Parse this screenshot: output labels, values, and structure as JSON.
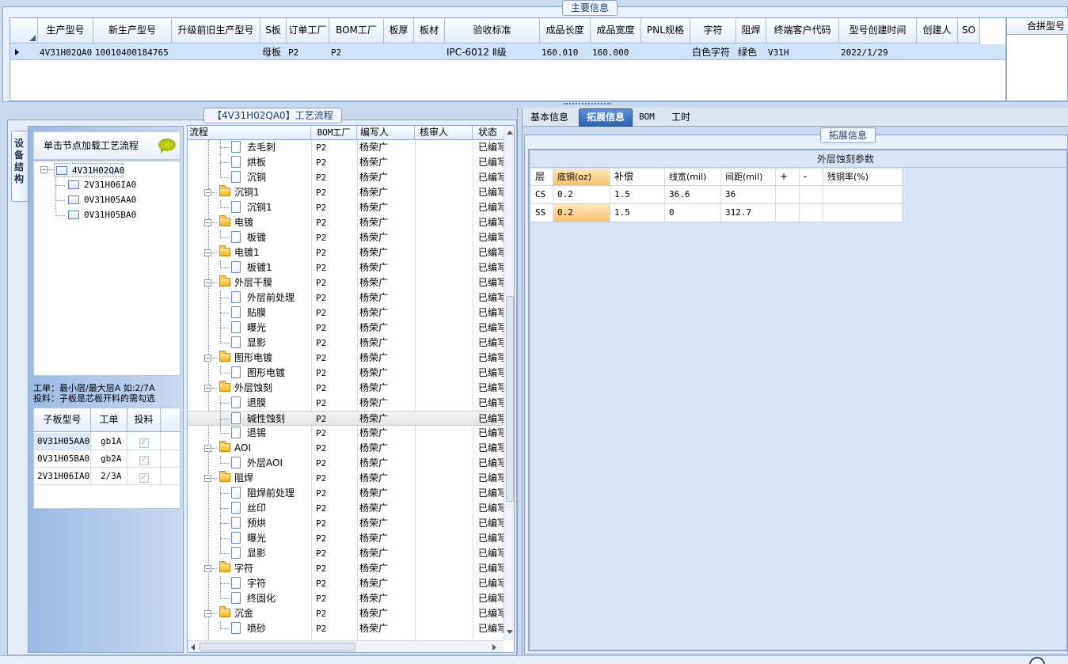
{
  "main_info": {
    "title": "主要信息",
    "merge_header": "合拼型号",
    "columns": [
      {
        "label": "生产型号",
        "w": 70
      },
      {
        "label": "新生产型号",
        "w": 99
      },
      {
        "label": "升级前旧生产型号",
        "w": 112
      },
      {
        "label": "S板",
        "w": 33
      },
      {
        "label": "订单工厂",
        "w": 54
      },
      {
        "label": "BOM工厂",
        "w": 69
      },
      {
        "label": "板厚",
        "w": 38
      },
      {
        "label": "板材",
        "w": 39
      },
      {
        "label": "验收标准",
        "w": 120
      },
      {
        "label": "成品长度",
        "w": 64
      },
      {
        "label": "成品宽度",
        "w": 64
      },
      {
        "label": "PNL规格",
        "w": 62
      },
      {
        "label": "字符",
        "w": 58
      },
      {
        "label": "阻焊",
        "w": 38
      },
      {
        "label": "终端客户代码",
        "w": 92
      },
      {
        "label": "型号创建时间",
        "w": 98
      },
      {
        "label": "创建人",
        "w": 52
      },
      {
        "label": "SO",
        "w": 28
      }
    ],
    "row": [
      "4V31H02QA0",
      "10010400184765",
      "",
      "母板",
      "P2",
      "P2",
      "",
      "",
      "IPC-6012 Ⅱ级",
      "160.010",
      "160.000",
      "",
      "白色字符",
      "绿色",
      "V31H",
      "2022/1/29",
      "",
      ""
    ]
  },
  "process": {
    "title": "【4V31H02QA0】工艺流程",
    "side_tab": "设备结构",
    "hint": "单击节点加载工艺流程",
    "note1": "工单：最小层/最大层A 如:2/7A",
    "note2": "投料：子板是芯板开料的需勾选",
    "headers": [
      "流程",
      "BOM工厂",
      "编写人",
      "核审人",
      "状态"
    ],
    "structure": [
      {
        "label": "4V31H02QA0",
        "level": 0
      },
      {
        "label": "2V31H06IA0",
        "level": 1
      },
      {
        "label": "0V31H05AA0",
        "level": 1
      },
      {
        "label": "0V31H05BA0",
        "level": 1
      }
    ],
    "rows": [
      {
        "name": "去毛刺",
        "type": "leaf",
        "factory": "P2",
        "author": "杨荣广",
        "reviewer": "",
        "status": "已编写"
      },
      {
        "name": "烘板",
        "type": "leaf",
        "factory": "P2",
        "author": "杨荣广",
        "reviewer": "",
        "status": "已编写"
      },
      {
        "name": "沉铜",
        "type": "leaf",
        "factory": "P2",
        "author": "杨荣广",
        "reviewer": "",
        "status": "已编写"
      },
      {
        "name": "沉铜1",
        "type": "folder",
        "factory": "P2",
        "author": "杨荣广",
        "reviewer": "",
        "status": "已编写"
      },
      {
        "name": "沉铜1",
        "type": "leaf",
        "factory": "P2",
        "author": "杨荣广",
        "reviewer": "",
        "status": "已编写"
      },
      {
        "name": "电镀",
        "type": "folder",
        "factory": "P2",
        "author": "杨荣广",
        "reviewer": "",
        "status": "已编写"
      },
      {
        "name": "板镀",
        "type": "leaf",
        "factory": "P2",
        "author": "杨荣广",
        "reviewer": "",
        "status": "已编写"
      },
      {
        "name": "电镀1",
        "type": "folder",
        "factory": "P2",
        "author": "杨荣广",
        "reviewer": "",
        "status": "已编写"
      },
      {
        "name": "板镀1",
        "type": "leaf",
        "factory": "P2",
        "author": "杨荣广",
        "reviewer": "",
        "status": "已编写"
      },
      {
        "name": "外层干膜",
        "type": "folder",
        "factory": "P2",
        "author": "杨荣广",
        "reviewer": "",
        "status": "已编写"
      },
      {
        "name": "外层前处理",
        "type": "leaf",
        "factory": "P2",
        "author": "杨荣广",
        "reviewer": "",
        "status": "已编写"
      },
      {
        "name": "贴膜",
        "type": "leaf",
        "factory": "P2",
        "author": "杨荣广",
        "reviewer": "",
        "status": "已编写"
      },
      {
        "name": "曝光",
        "type": "leaf",
        "factory": "P2",
        "author": "杨荣广",
        "reviewer": "",
        "status": "已编写"
      },
      {
        "name": "显影",
        "type": "leaf",
        "factory": "P2",
        "author": "杨荣广",
        "reviewer": "",
        "status": "已编写"
      },
      {
        "name": "图形电镀",
        "type": "folder",
        "factory": "P2",
        "author": "杨荣广",
        "reviewer": "",
        "status": "已编写"
      },
      {
        "name": "图形电镀",
        "type": "leaf",
        "factory": "P2",
        "author": "杨荣广",
        "reviewer": "",
        "status": "已编写"
      },
      {
        "name": "外层蚀刻",
        "type": "folder",
        "factory": "P2",
        "author": "杨荣广",
        "reviewer": "",
        "status": "已编写"
      },
      {
        "name": "退膜",
        "type": "leaf",
        "factory": "P2",
        "author": "杨荣广",
        "reviewer": "",
        "status": "已编写"
      },
      {
        "name": "碱性蚀刻",
        "type": "leaf",
        "factory": "P2",
        "author": "杨荣广",
        "reviewer": "",
        "status": "已编写",
        "selected": true
      },
      {
        "name": "退锡",
        "type": "leaf",
        "factory": "P2",
        "author": "杨荣广",
        "reviewer": "",
        "status": "已编写"
      },
      {
        "name": "AOI",
        "type": "folder",
        "factory": "P2",
        "author": "杨荣广",
        "reviewer": "",
        "status": "已编写"
      },
      {
        "name": "外层AOI",
        "type": "leaf",
        "factory": "P2",
        "author": "杨荣广",
        "reviewer": "",
        "status": "已编写"
      },
      {
        "name": "阻焊",
        "type": "folder",
        "factory": "P2",
        "author": "杨荣广",
        "reviewer": "",
        "status": "已编写"
      },
      {
        "name": "阻焊前处理",
        "type": "leaf",
        "factory": "P2",
        "author": "杨荣广",
        "reviewer": "",
        "status": "已编写"
      },
      {
        "name": "丝印",
        "type": "leaf",
        "factory": "P2",
        "author": "杨荣广",
        "reviewer": "",
        "status": "已编写"
      },
      {
        "name": "预烘",
        "type": "leaf",
        "factory": "P2",
        "author": "杨荣广",
        "reviewer": "",
        "status": "已编写"
      },
      {
        "name": "曝光",
        "type": "leaf",
        "factory": "P2",
        "author": "杨荣广",
        "reviewer": "",
        "status": "已编写"
      },
      {
        "name": "显影",
        "type": "leaf",
        "factory": "P2",
        "author": "杨荣广",
        "reviewer": "",
        "status": "已编写"
      },
      {
        "name": "字符",
        "type": "folder",
        "factory": "P2",
        "author": "杨荣广",
        "reviewer": "",
        "status": "已编写"
      },
      {
        "name": "字符",
        "type": "leaf",
        "factory": "P2",
        "author": "杨荣广",
        "reviewer": "",
        "status": "已编写"
      },
      {
        "name": "终固化",
        "type": "leaf",
        "factory": "P2",
        "author": "杨荣广",
        "reviewer": "",
        "status": "已编写"
      },
      {
        "name": "沉金",
        "type": "folder",
        "factory": "P2",
        "author": "杨荣广",
        "reviewer": "",
        "status": "已编写"
      },
      {
        "name": "喷砂",
        "type": "leaf",
        "factory": "P2",
        "author": "杨荣广",
        "reviewer": "",
        "status": "已编写"
      }
    ]
  },
  "subboards": {
    "headers": [
      "子板型号",
      "工单",
      "投料"
    ],
    "rows": [
      {
        "model": "0V31H05AA0",
        "order": "gb1A",
        "feed": "✓",
        "selected": true
      },
      {
        "model": "0V31H05BA0",
        "order": "gb2A",
        "feed": "✓"
      },
      {
        "model": "2V31H06IA0",
        "order": "2/3A",
        "feed": "✓"
      }
    ]
  },
  "tabs": [
    {
      "label": "基本信息",
      "active": false
    },
    {
      "label": "拓展信息",
      "active": true
    },
    {
      "label": "BOM",
      "active": false
    },
    {
      "label": "工时",
      "active": false
    }
  ],
  "extended": {
    "title": "拓展信息",
    "etching_title": "外层蚀刻参数",
    "headers": [
      "层",
      "底铜(oz)",
      "补偿",
      "线宽(mil)",
      "间距(mil)",
      "+",
      "-",
      "残铜率(%)"
    ],
    "rows": [
      [
        "CS",
        "0.2",
        "1.5",
        "36.6",
        "36",
        "",
        "",
        ""
      ],
      [
        "SS",
        "0.2",
        "1.5",
        "0",
        "312.7",
        "",
        "",
        ""
      ]
    ]
  }
}
